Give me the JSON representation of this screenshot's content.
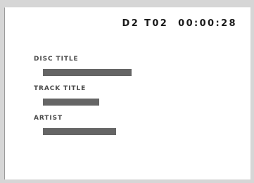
{
  "display": {
    "disc_indicator": "D2",
    "track_indicator": "T02",
    "elapsed_time": "00:00:28"
  },
  "fields": [
    {
      "label": "DISC TITLE",
      "value_fill": 0.7
    },
    {
      "label": "TRACK TITLE",
      "value_fill": 0.45
    },
    {
      "label": "ARTIST",
      "value_fill": 0.58
    }
  ],
  "colors": {
    "background": "#d6d6d6",
    "panel": "#ffffff",
    "label_text": "#4a4a4a",
    "status_text": "#1a1a1a",
    "redacted_bar": "#656565"
  }
}
